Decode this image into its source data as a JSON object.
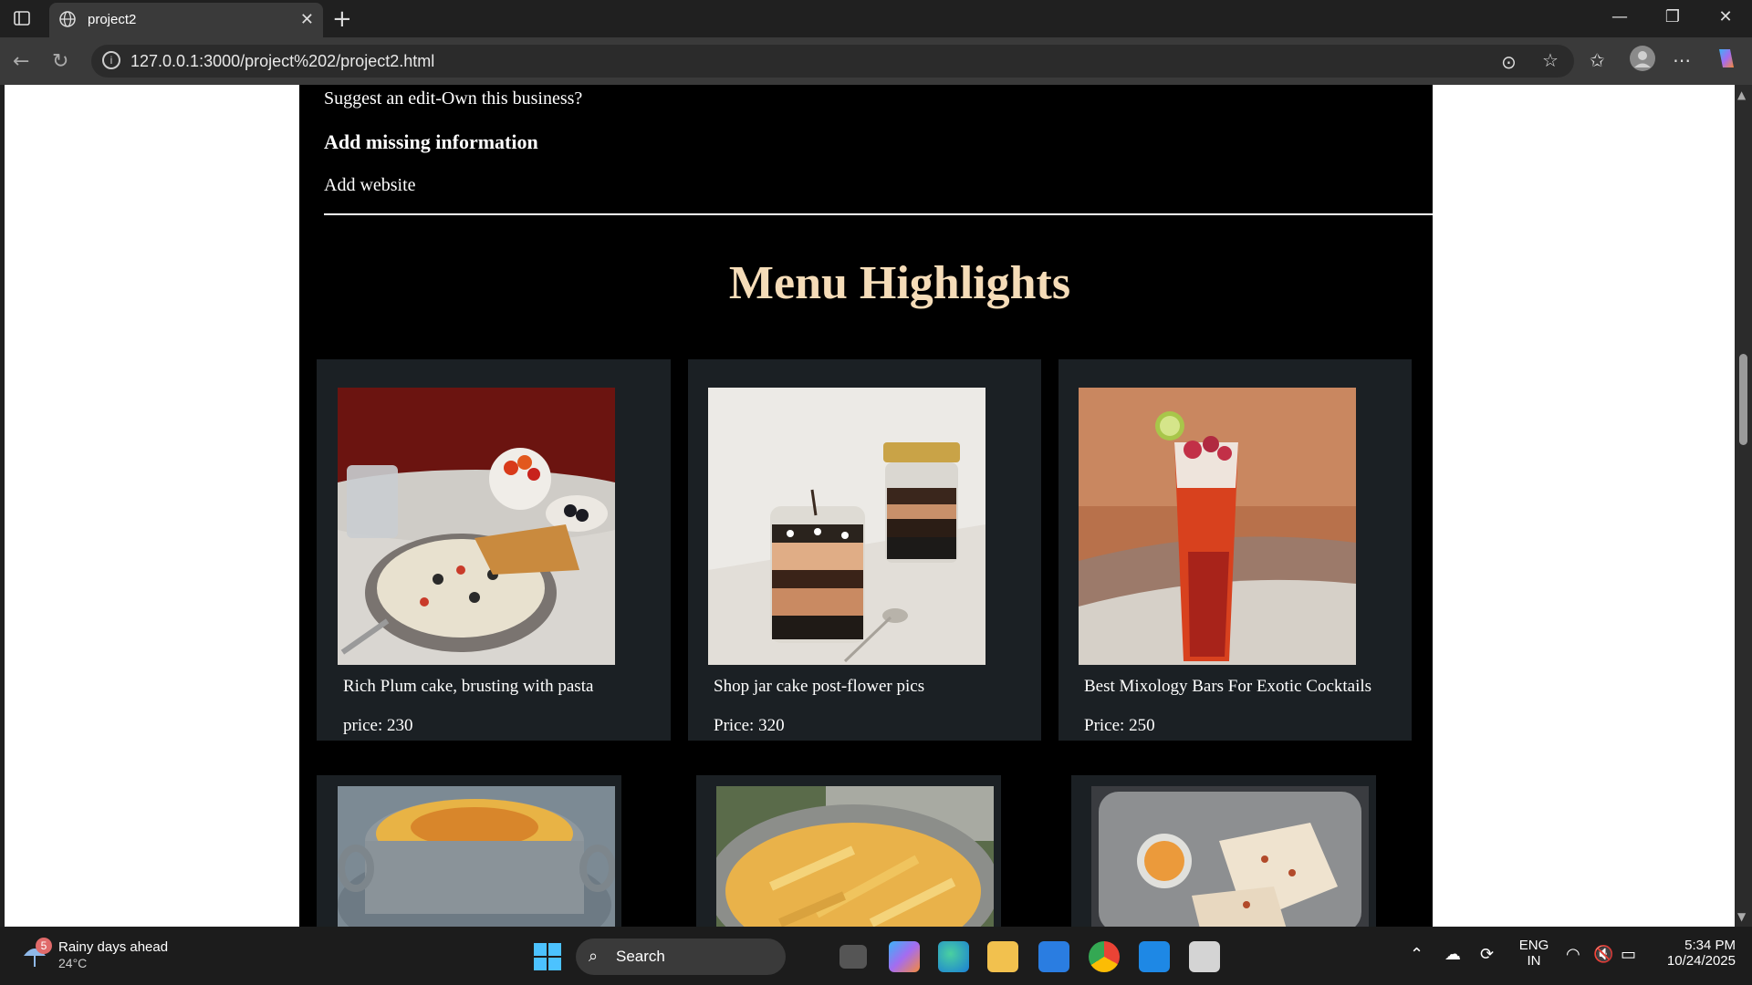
{
  "browser": {
    "tab_title": "project2",
    "url": "127.0.0.1:3000/project%202/project2.html"
  },
  "page": {
    "suggest_edit": "Suggest an edit-Own this business?",
    "missing_heading": "Add missing information",
    "add_website": "Add website",
    "menu_title": "Menu Highlights",
    "title_color": "#f5dcb8",
    "card_color": "#1b2024",
    "cards": [
      {
        "name": "Rich Plum cake, brusting with pasta",
        "price": "price: 230",
        "image": "pasta-bowl-photo"
      },
      {
        "name": "Shop jar cake post-flower pics",
        "price": "Price: 320",
        "image": "jar-cake-photo"
      },
      {
        "name": "Best Mixology Bars For Exotic Cocktails",
        "price": "Price: 250",
        "image": "cocktail-photo"
      },
      {
        "image": "baked-casserole-photo"
      },
      {
        "image": "pasta-fries-photo"
      },
      {
        "image": "chicken-platter-photo"
      }
    ]
  },
  "taskbar": {
    "weather_forecast": "Rainy days ahead",
    "weather_temp": "24°C",
    "weather_badge": "5",
    "search_label": "Search",
    "lang_top": "ENG",
    "lang_bottom": "IN",
    "time": "5:34 PM",
    "date": "10/24/2025"
  }
}
